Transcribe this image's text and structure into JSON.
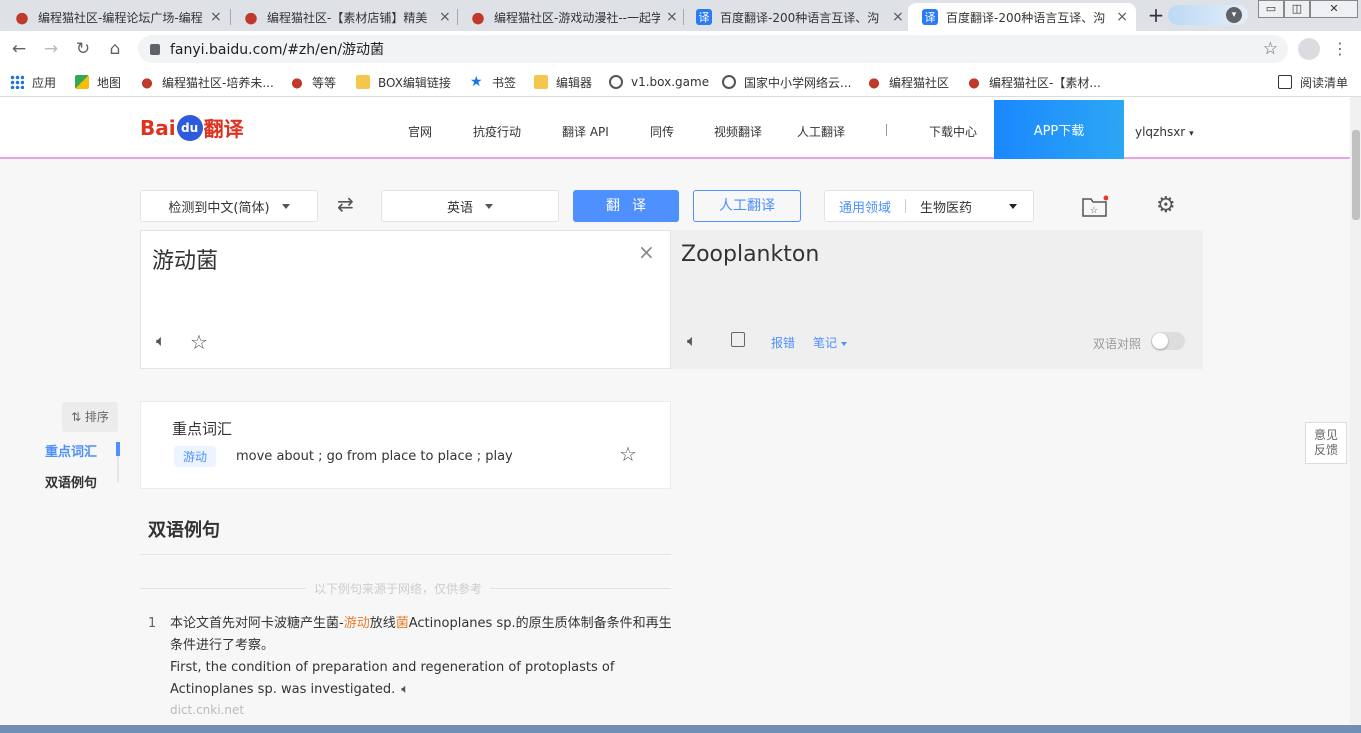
{
  "browser": {
    "tabs": [
      {
        "title": "编程猫社区-编程论坛广场-编程",
        "icon": "cat-icon"
      },
      {
        "title": "编程猫社区-【素材店铺】精美",
        "icon": "cat-icon"
      },
      {
        "title": "编程猫社区-游戏动漫社--一起学",
        "icon": "cat-icon"
      },
      {
        "title": "百度翻译-200种语言互译、沟",
        "icon": "baidu-translate-icon"
      },
      {
        "title": "百度翻译-200种语言互译、沟",
        "icon": "baidu-translate-icon"
      }
    ],
    "url": "fanyi.baidu.com/#zh/en/游动菌",
    "bookmarks": [
      {
        "label": "应用",
        "icon": "apps-icon"
      },
      {
        "label": "地图",
        "icon": "maps-icon"
      },
      {
        "label": "编程猫社区-培养未...",
        "icon": "cat-icon"
      },
      {
        "label": "等等",
        "icon": "cat-icon"
      },
      {
        "label": "BOX编辑链接",
        "icon": "folder-icon"
      },
      {
        "label": "书签",
        "icon": "star-icon"
      },
      {
        "label": "编辑器",
        "icon": "folder-icon"
      },
      {
        "label": "v1.box.game",
        "icon": "globe-icon"
      },
      {
        "label": "国家中小学网络云...",
        "icon": "globe-icon"
      },
      {
        "label": "编程猫社区",
        "icon": "cat-icon"
      },
      {
        "label": "编程猫社区-【素材...",
        "icon": "cat-icon"
      }
    ],
    "reading_list": "阅读清单"
  },
  "header": {
    "logo_bai": "Bai",
    "logo_du": "du",
    "logo_fy": "翻译",
    "nav": [
      "官网",
      "抗疫行动",
      "翻译 API",
      "同传",
      "视频翻译",
      "人工翻译",
      "下载中心"
    ],
    "app_download": "APP下载",
    "username": "ylqzhsxr"
  },
  "controls": {
    "source_lang": "检测到中文(简体)",
    "target_lang": "英语",
    "translate": "翻译",
    "human_translate": "人工翻译",
    "domain_general": "通用领域",
    "domain_selected": "生物医药"
  },
  "input": {
    "text": "游动菌"
  },
  "output": {
    "text": "Zooplankton",
    "report": "报错",
    "notes": "笔记",
    "bilingual": "双语对照"
  },
  "sidebar": {
    "sort": "⇅ 排序",
    "items": [
      "重点词汇",
      "双语例句"
    ]
  },
  "vocab": {
    "title": "重点词汇",
    "word": "游动",
    "definition": "move about ; go from place to place ; play"
  },
  "examples": {
    "heading": "双语例句",
    "note": "以下例句来源于网络，仅供参考",
    "items": [
      {
        "num": "1",
        "zh_pre": "本论文首先对阿卡波糖产生菌-",
        "zh_hl1": "游动",
        "zh_mid": "放线",
        "zh_hl2": "菌",
        "zh_post": "Actinoplanes sp.的原生质体制备条件和再生条件进行了考察。",
        "en": "First, the condition of preparation and regeneration of protoplasts of Actinoplanes sp. was investigated.",
        "source": "dict.cnki.net"
      }
    ]
  },
  "feedback": {
    "line1": "意见",
    "line2": "反馈"
  },
  "colors": {
    "accent": "#4d90fe",
    "logo_red": "#de3320",
    "highlight": "#ef7b2d"
  }
}
